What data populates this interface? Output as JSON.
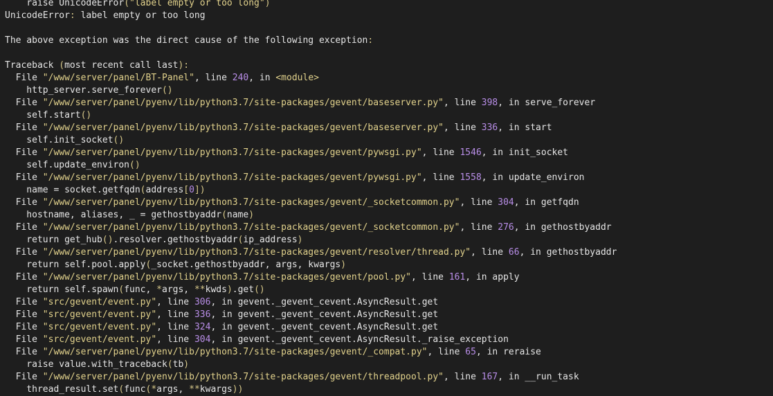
{
  "colors": {
    "background": "#1e1e1e",
    "text": "#e8e8e8",
    "string": "#e2d28c",
    "number": "#b98ee8",
    "punctuation": "#d8c98a"
  },
  "lines": [
    [
      {
        "t": "    raise UnicodeError",
        "c": "plain"
      },
      {
        "t": "(",
        "c": "punc"
      },
      {
        "t": "\"label empty or too long\"",
        "c": "str"
      },
      {
        "t": ")",
        "c": "punc"
      }
    ],
    [
      {
        "t": "UnicodeError",
        "c": "plain"
      },
      {
        "t": ":",
        "c": "punc"
      },
      {
        "t": " label empty or too long",
        "c": "plain"
      }
    ],
    [],
    [
      {
        "t": "The above exception was the direct cause of the following exception",
        "c": "plain"
      },
      {
        "t": ":",
        "c": "punc"
      }
    ],
    [],
    [
      {
        "t": "Traceback ",
        "c": "plain"
      },
      {
        "t": "(",
        "c": "punc"
      },
      {
        "t": "most recent call last",
        "c": "plain"
      },
      {
        "t": "):",
        "c": "punc"
      }
    ],
    [
      {
        "t": "  File ",
        "c": "plain"
      },
      {
        "t": "\"/www/server/panel/BT-Panel\"",
        "c": "str"
      },
      {
        "t": ", line ",
        "c": "plain"
      },
      {
        "t": "240",
        "c": "num"
      },
      {
        "t": ", in ",
        "c": "plain"
      },
      {
        "t": "<module>",
        "c": "str"
      }
    ],
    [
      {
        "t": "    http_server.serve_forever",
        "c": "plain"
      },
      {
        "t": "()",
        "c": "punc"
      }
    ],
    [
      {
        "t": "  File ",
        "c": "plain"
      },
      {
        "t": "\"/www/server/panel/pyenv/lib/python3.7/site-packages/gevent/baseserver.py\"",
        "c": "str"
      },
      {
        "t": ", line ",
        "c": "plain"
      },
      {
        "t": "398",
        "c": "num"
      },
      {
        "t": ", in serve_forever",
        "c": "plain"
      }
    ],
    [
      {
        "t": "    self.start",
        "c": "plain"
      },
      {
        "t": "()",
        "c": "punc"
      }
    ],
    [
      {
        "t": "  File ",
        "c": "plain"
      },
      {
        "t": "\"/www/server/panel/pyenv/lib/python3.7/site-packages/gevent/baseserver.py\"",
        "c": "str"
      },
      {
        "t": ", line ",
        "c": "plain"
      },
      {
        "t": "336",
        "c": "num"
      },
      {
        "t": ", in start",
        "c": "plain"
      }
    ],
    [
      {
        "t": "    self.init_socket",
        "c": "plain"
      },
      {
        "t": "()",
        "c": "punc"
      }
    ],
    [
      {
        "t": "  File ",
        "c": "plain"
      },
      {
        "t": "\"/www/server/panel/pyenv/lib/python3.7/site-packages/gevent/pywsgi.py\"",
        "c": "str"
      },
      {
        "t": ", line ",
        "c": "plain"
      },
      {
        "t": "1546",
        "c": "num"
      },
      {
        "t": ", in init_socket",
        "c": "plain"
      }
    ],
    [
      {
        "t": "    self.update_environ",
        "c": "plain"
      },
      {
        "t": "()",
        "c": "punc"
      }
    ],
    [
      {
        "t": "  File ",
        "c": "plain"
      },
      {
        "t": "\"/www/server/panel/pyenv/lib/python3.7/site-packages/gevent/pywsgi.py\"",
        "c": "str"
      },
      {
        "t": ", line ",
        "c": "plain"
      },
      {
        "t": "1558",
        "c": "num"
      },
      {
        "t": ", in update_environ",
        "c": "plain"
      }
    ],
    [
      {
        "t": "    name = socket.getfqdn",
        "c": "plain"
      },
      {
        "t": "(",
        "c": "punc"
      },
      {
        "t": "address",
        "c": "plain"
      },
      {
        "t": "[",
        "c": "punc"
      },
      {
        "t": "0",
        "c": "num"
      },
      {
        "t": "])",
        "c": "punc"
      }
    ],
    [
      {
        "t": "  File ",
        "c": "plain"
      },
      {
        "t": "\"/www/server/panel/pyenv/lib/python3.7/site-packages/gevent/_socketcommon.py\"",
        "c": "str"
      },
      {
        "t": ", line ",
        "c": "plain"
      },
      {
        "t": "304",
        "c": "num"
      },
      {
        "t": ", in getfqdn",
        "c": "plain"
      }
    ],
    [
      {
        "t": "    hostname, aliases, _ = gethostbyaddr",
        "c": "plain"
      },
      {
        "t": "(",
        "c": "punc"
      },
      {
        "t": "name",
        "c": "plain"
      },
      {
        "t": ")",
        "c": "punc"
      }
    ],
    [
      {
        "t": "  File ",
        "c": "plain"
      },
      {
        "t": "\"/www/server/panel/pyenv/lib/python3.7/site-packages/gevent/_socketcommon.py\"",
        "c": "str"
      },
      {
        "t": ", line ",
        "c": "plain"
      },
      {
        "t": "276",
        "c": "num"
      },
      {
        "t": ", in gethostbyaddr",
        "c": "plain"
      }
    ],
    [
      {
        "t": "    return get_hub",
        "c": "plain"
      },
      {
        "t": "()",
        "c": "punc"
      },
      {
        "t": ".resolver.gethostbyaddr",
        "c": "plain"
      },
      {
        "t": "(",
        "c": "punc"
      },
      {
        "t": "ip_address",
        "c": "plain"
      },
      {
        "t": ")",
        "c": "punc"
      }
    ],
    [
      {
        "t": "  File ",
        "c": "plain"
      },
      {
        "t": "\"/www/server/panel/pyenv/lib/python3.7/site-packages/gevent/resolver/thread.py\"",
        "c": "str"
      },
      {
        "t": ", line ",
        "c": "plain"
      },
      {
        "t": "66",
        "c": "num"
      },
      {
        "t": ", in gethostbyaddr",
        "c": "plain"
      }
    ],
    [
      {
        "t": "    return self.pool.apply",
        "c": "plain"
      },
      {
        "t": "(",
        "c": "punc"
      },
      {
        "t": "_socket.gethostbyaddr, args, kwargs",
        "c": "plain"
      },
      {
        "t": ")",
        "c": "punc"
      }
    ],
    [
      {
        "t": "  File ",
        "c": "plain"
      },
      {
        "t": "\"/www/server/panel/pyenv/lib/python3.7/site-packages/gevent/pool.py\"",
        "c": "str"
      },
      {
        "t": ", line ",
        "c": "plain"
      },
      {
        "t": "161",
        "c": "num"
      },
      {
        "t": ", in apply",
        "c": "plain"
      }
    ],
    [
      {
        "t": "    return self.spawn",
        "c": "plain"
      },
      {
        "t": "(",
        "c": "punc"
      },
      {
        "t": "func, ",
        "c": "plain"
      },
      {
        "t": "*",
        "c": "punc"
      },
      {
        "t": "args, ",
        "c": "plain"
      },
      {
        "t": "**",
        "c": "punc"
      },
      {
        "t": "kwds",
        "c": "plain"
      },
      {
        "t": ")",
        "c": "punc"
      },
      {
        "t": ".get",
        "c": "plain"
      },
      {
        "t": "()",
        "c": "punc"
      }
    ],
    [
      {
        "t": "  File ",
        "c": "plain"
      },
      {
        "t": "\"src/gevent/event.py\"",
        "c": "str"
      },
      {
        "t": ", line ",
        "c": "plain"
      },
      {
        "t": "306",
        "c": "num"
      },
      {
        "t": ", in gevent._gevent_cevent.AsyncResult.get",
        "c": "plain"
      }
    ],
    [
      {
        "t": "  File ",
        "c": "plain"
      },
      {
        "t": "\"src/gevent/event.py\"",
        "c": "str"
      },
      {
        "t": ", line ",
        "c": "plain"
      },
      {
        "t": "336",
        "c": "num"
      },
      {
        "t": ", in gevent._gevent_cevent.AsyncResult.get",
        "c": "plain"
      }
    ],
    [
      {
        "t": "  File ",
        "c": "plain"
      },
      {
        "t": "\"src/gevent/event.py\"",
        "c": "str"
      },
      {
        "t": ", line ",
        "c": "plain"
      },
      {
        "t": "324",
        "c": "num"
      },
      {
        "t": ", in gevent._gevent_cevent.AsyncResult.get",
        "c": "plain"
      }
    ],
    [
      {
        "t": "  File ",
        "c": "plain"
      },
      {
        "t": "\"src/gevent/event.py\"",
        "c": "str"
      },
      {
        "t": ", line ",
        "c": "plain"
      },
      {
        "t": "304",
        "c": "num"
      },
      {
        "t": ", in gevent._gevent_cevent.AsyncResult._raise_exception",
        "c": "plain"
      }
    ],
    [
      {
        "t": "  File ",
        "c": "plain"
      },
      {
        "t": "\"/www/server/panel/pyenv/lib/python3.7/site-packages/gevent/_compat.py\"",
        "c": "str"
      },
      {
        "t": ", line ",
        "c": "plain"
      },
      {
        "t": "65",
        "c": "num"
      },
      {
        "t": ", in reraise",
        "c": "plain"
      }
    ],
    [
      {
        "t": "    raise value.with_traceback",
        "c": "plain"
      },
      {
        "t": "(",
        "c": "punc"
      },
      {
        "t": "tb",
        "c": "plain"
      },
      {
        "t": ")",
        "c": "punc"
      }
    ],
    [
      {
        "t": "  File ",
        "c": "plain"
      },
      {
        "t": "\"/www/server/panel/pyenv/lib/python3.7/site-packages/gevent/threadpool.py\"",
        "c": "str"
      },
      {
        "t": ", line ",
        "c": "plain"
      },
      {
        "t": "167",
        "c": "num"
      },
      {
        "t": ", in __run_task",
        "c": "plain"
      }
    ],
    [
      {
        "t": "    thread_result.set",
        "c": "plain"
      },
      {
        "t": "(",
        "c": "punc"
      },
      {
        "t": "func",
        "c": "plain"
      },
      {
        "t": "(",
        "c": "punc"
      },
      {
        "t": "*",
        "c": "punc"
      },
      {
        "t": "args, ",
        "c": "plain"
      },
      {
        "t": "**",
        "c": "punc"
      },
      {
        "t": "kwargs",
        "c": "plain"
      },
      {
        "t": "))",
        "c": "punc"
      }
    ]
  ]
}
